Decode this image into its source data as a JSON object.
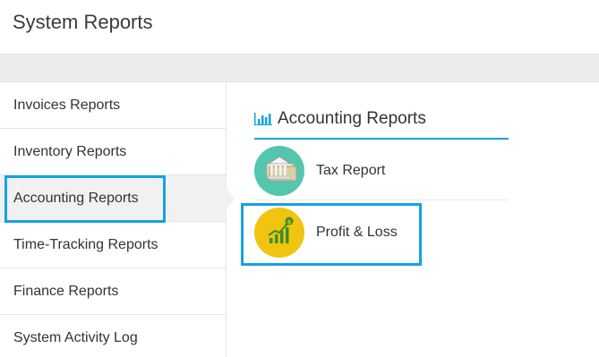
{
  "header": {
    "title": "System Reports"
  },
  "sidebar": {
    "items": [
      {
        "label": "Invoices Reports",
        "active": false
      },
      {
        "label": "Inventory Reports",
        "active": false
      },
      {
        "label": "Accounting Reports",
        "active": true
      },
      {
        "label": "Time-Tracking Reports",
        "active": false
      },
      {
        "label": "Finance Reports",
        "active": false
      },
      {
        "label": "System Activity Log",
        "active": false
      }
    ]
  },
  "main": {
    "section_title": "Accounting Reports",
    "section_icon": "bar-chart-icon",
    "reports": [
      {
        "label": "Tax Report",
        "icon": "bank-money-icon",
        "color": "#55c6ae"
      },
      {
        "label": "Profit & Loss",
        "icon": "growth-chart-dollar-icon",
        "color": "#f1c40f"
      }
    ]
  },
  "colors": {
    "accent": "#16a2e0",
    "active_bg": "#f1f1f1",
    "band_bg": "#ececec"
  }
}
